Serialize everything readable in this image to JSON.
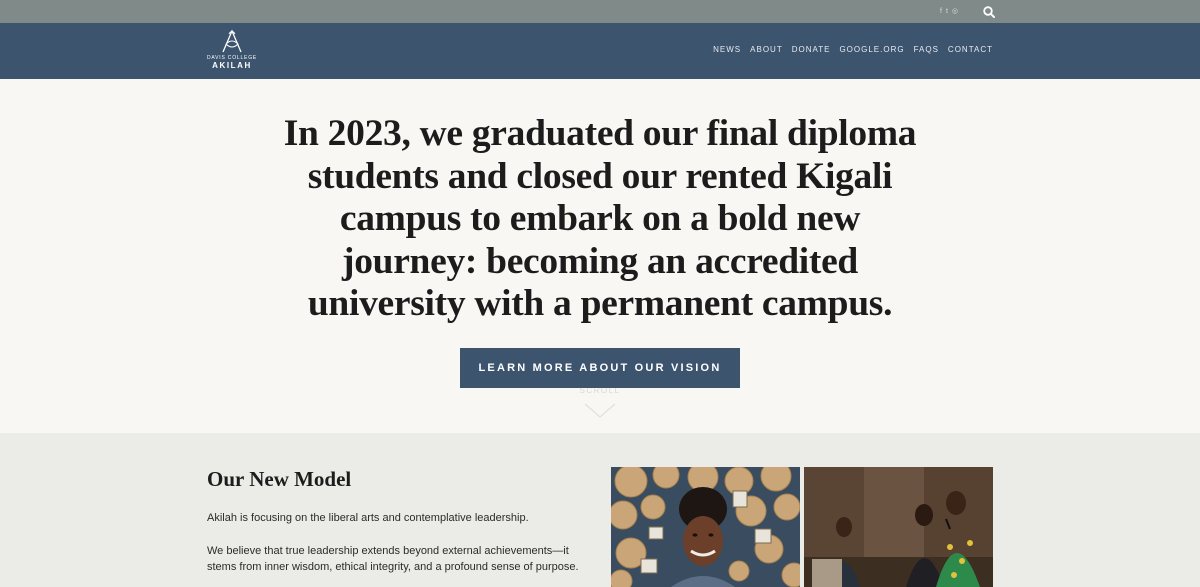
{
  "topbar": {
    "social": [
      "f",
      "t",
      "◎"
    ],
    "search_icon": "search-icon"
  },
  "logo": {
    "line1": "DAVIS COLLEGE",
    "line2": "AKILAH"
  },
  "nav": {
    "items": [
      "NEWS",
      "ABOUT",
      "DONATE",
      "GOOGLE.ORG",
      "FAQS",
      "CONTACT"
    ]
  },
  "hero": {
    "title": "In 2023, we graduated our final diploma students and closed our rented Kigali campus to embark on a bold new journey: becoming an accredited university with a permanent campus.",
    "cta_label": "LEARN MORE ABOUT OUR VISION",
    "scroll_label": "SCROLL"
  },
  "model": {
    "heading": "Our New Model",
    "paragraph1": "Akilah is focusing on the liberal arts and contemplative leadership.",
    "paragraph2": "We believe that true leadership extends beyond external achievements—it stems from inner wisdom, ethical integrity, and a profound sense of purpose."
  },
  "colors": {
    "topbar": "#7f8a89",
    "navbar": "#3c546e",
    "hero_bg": "#f8f7f4",
    "section_bg": "#ebebe8",
    "button": "#3c546e"
  }
}
